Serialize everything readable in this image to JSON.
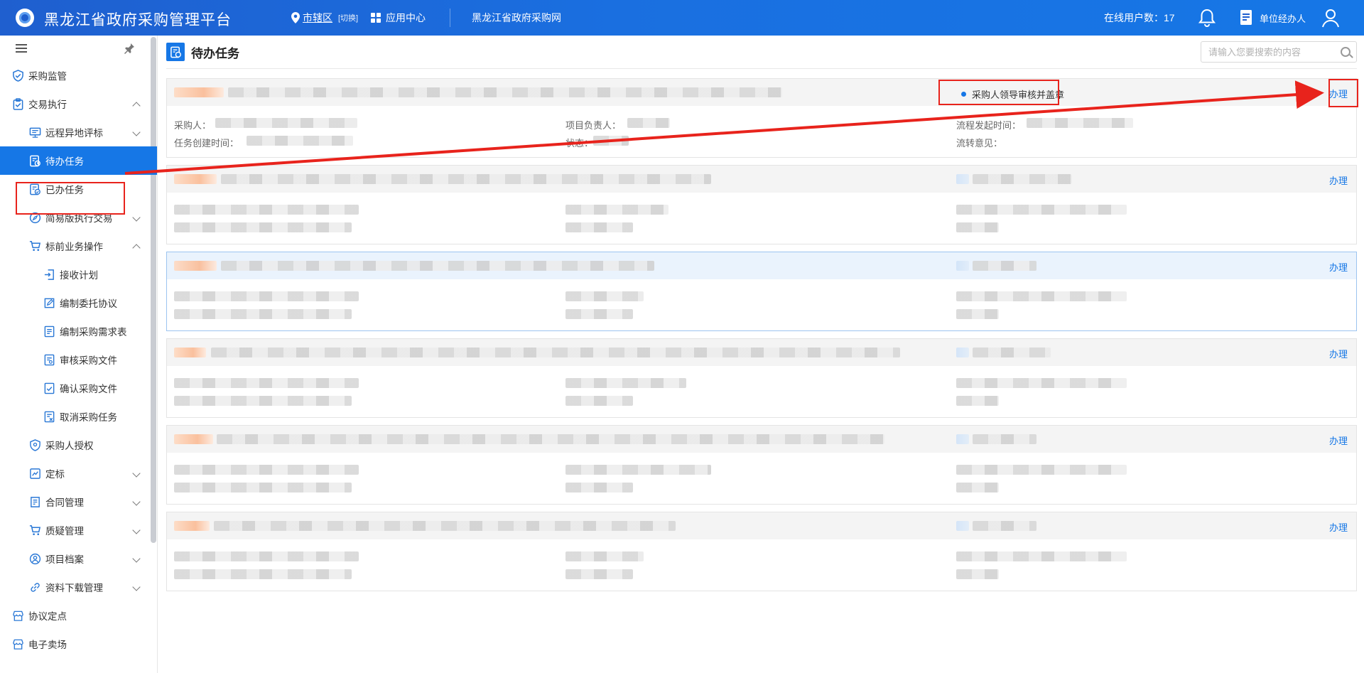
{
  "header": {
    "title": "黑龙江省政府采购管理平台",
    "region": "市辖区",
    "switch": "[切换]",
    "app_center": "应用中心",
    "portal": "黑龙江省政府采购网",
    "online_label": "在线用户数：17",
    "role": "单位经办人"
  },
  "sidebar": {
    "items": [
      {
        "label": "采购监管",
        "icon": "shield-icon"
      },
      {
        "label": "交易执行",
        "icon": "clipboard-icon"
      },
      {
        "label": "远程异地评标",
        "icon": "monitor-icon"
      },
      {
        "label": "待办任务",
        "icon": "task-icon"
      },
      {
        "label": "已办任务",
        "icon": "task-done-icon"
      },
      {
        "label": "简易版执行交易",
        "icon": "compass-icon"
      },
      {
        "label": "标前业务操作",
        "icon": "cart-icon"
      },
      {
        "label": "接收计划",
        "icon": "receive-icon"
      },
      {
        "label": "编制委托协议",
        "icon": "edit-icon"
      },
      {
        "label": "编制采购需求表",
        "icon": "list-icon"
      },
      {
        "label": "审核采购文件",
        "icon": "audit-icon"
      },
      {
        "label": "确认采购文件",
        "icon": "confirm-icon"
      },
      {
        "label": "取消采购任务",
        "icon": "cancel-doc-icon"
      },
      {
        "label": "采购人授权",
        "icon": "auth-icon"
      },
      {
        "label": "定标",
        "icon": "award-icon"
      },
      {
        "label": "合同管理",
        "icon": "contract-icon"
      },
      {
        "label": "质疑管理",
        "icon": "cart-icon"
      },
      {
        "label": "项目档案",
        "icon": "user-circle-icon"
      },
      {
        "label": "资料下载管理",
        "icon": "link-icon"
      },
      {
        "label": "协议定点",
        "icon": "store-icon"
      },
      {
        "label": "电子卖场",
        "icon": "store-icon"
      }
    ]
  },
  "main": {
    "title": "待办任务",
    "search_placeholder": "请输入您要搜索的内容",
    "do_label": "办理",
    "first_card": {
      "status": "采购人领导审核并盖章",
      "purchaser_label": "采购人：",
      "manager_label": "项目负责人：",
      "flow_start_label": "流程发起时间：",
      "created_label": "任务创建时间：",
      "state_label": "状态：",
      "flow_opinion_label": "流转意见："
    }
  },
  "colors": {
    "header_blue": "#1f5fcf",
    "accent": "#1677e6",
    "annotation_red": "#e8231c"
  }
}
